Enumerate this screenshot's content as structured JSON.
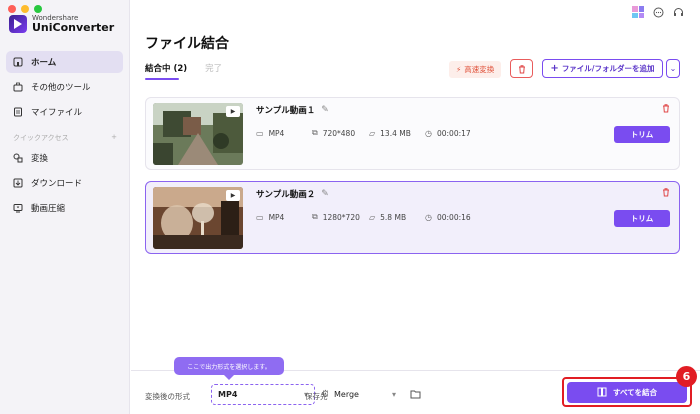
{
  "app": {
    "brand": "Wondershare",
    "product": "UniConverter"
  },
  "sidebar": {
    "items": [
      {
        "label": "ホーム",
        "icon": "home-icon"
      },
      {
        "label": "その他のツール",
        "icon": "toolbox-icon"
      },
      {
        "label": "マイファイル",
        "icon": "file-icon"
      }
    ],
    "quick_access_label": "クイックアクセス",
    "quick_items": [
      {
        "label": "変換",
        "icon": "convert-icon"
      },
      {
        "label": "ダウンロード",
        "icon": "download-icon"
      },
      {
        "label": "動画圧縮",
        "icon": "compress-icon"
      }
    ]
  },
  "header": {
    "title": "ファイル結合",
    "tabs": [
      {
        "label": "結合中 (2)"
      },
      {
        "label": "完了"
      }
    ],
    "fast_convert_label": "高速変換",
    "add_files_label": "ファイル/フォルダーを追加"
  },
  "files": [
    {
      "title": "サンプル動画１",
      "format": "MP4",
      "resolution": "720*480",
      "size": "13.4 MB",
      "duration": "00:00:17",
      "trim_label": "トリム"
    },
    {
      "title": "サンプル動画２",
      "format": "MP4",
      "resolution": "1280*720",
      "size": "5.8 MB",
      "duration": "00:00:16",
      "trim_label": "トリム"
    }
  ],
  "bottom": {
    "format_label": "変換後の形式",
    "format_value": "MP4",
    "tooltip": "ここで出力形式を選択します。",
    "destination_label": "保存先",
    "destination_value": "Merge",
    "merge_all_label": "すべてを結合",
    "step_badge": "6"
  },
  "colors": {
    "accent": "#7a4cf0",
    "highlight": "#e11d24",
    "danger": "#e04646"
  }
}
